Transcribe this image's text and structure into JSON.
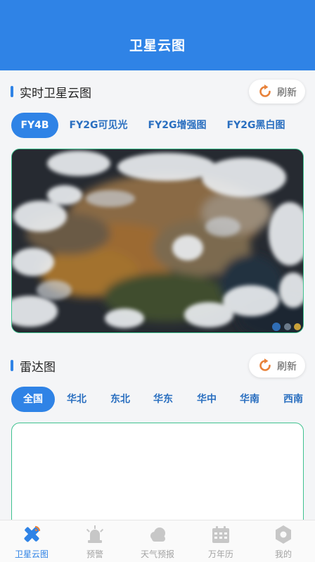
{
  "appbar": {
    "title": "卫星云图"
  },
  "satellite_section": {
    "title": "实时卫星云图",
    "refresh_label": "刷新",
    "tabs": [
      "FY4B",
      "FY2G可见光",
      "FY2G增强图",
      "FY2G黑白图"
    ],
    "active_tab": 0
  },
  "radar_section": {
    "title": "雷达图",
    "refresh_label": "刷新",
    "tabs": [
      "全国",
      "华北",
      "东北",
      "华东",
      "华中",
      "华南",
      "西南"
    ],
    "active_tab": 0
  },
  "bottom_nav": {
    "items": [
      {
        "label": "卫星云图",
        "icon": "satellite-icon",
        "active": true
      },
      {
        "label": "预警",
        "icon": "alarm-siren-icon",
        "active": false
      },
      {
        "label": "天气预报",
        "icon": "cloud-icon",
        "active": false
      },
      {
        "label": "万年历",
        "icon": "calendar-icon",
        "active": false
      },
      {
        "label": "我的",
        "icon": "profile-hexagon-icon",
        "active": false
      }
    ]
  },
  "colors": {
    "primary": "#2f83e6",
    "frame_border": "#3ec28f",
    "refresh_icon": "#e8823a"
  }
}
